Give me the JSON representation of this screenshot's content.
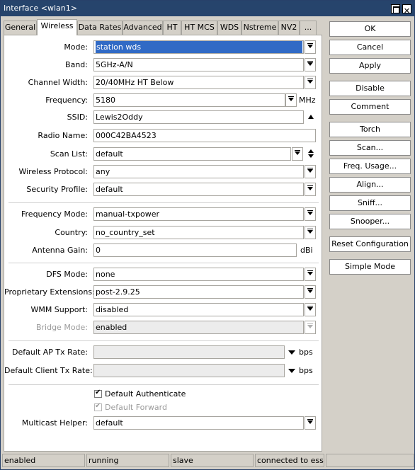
{
  "window": {
    "title": "Interface <wlan1>"
  },
  "tabs": [
    "General",
    "Wireless",
    "Data Rates",
    "Advanced",
    "HT",
    "HT MCS",
    "WDS",
    "Nstreme",
    "NV2",
    "..."
  ],
  "active_tab": "Wireless",
  "form": {
    "mode": {
      "label": "Mode:",
      "value": "station wds"
    },
    "band": {
      "label": "Band:",
      "value": "5GHz-A/N"
    },
    "channel_width": {
      "label": "Channel Width:",
      "value": "20/40MHz HT Below"
    },
    "frequency": {
      "label": "Frequency:",
      "value": "5180",
      "unit": "MHz"
    },
    "ssid": {
      "label": "SSID:",
      "value": "Lewis2Oddy"
    },
    "radio_name": {
      "label": "Radio Name:",
      "value": "000C42BA4523"
    },
    "scan_list": {
      "label": "Scan List:",
      "value": "default"
    },
    "wireless_protocol": {
      "label": "Wireless Protocol:",
      "value": "any"
    },
    "security_profile": {
      "label": "Security Profile:",
      "value": "default"
    },
    "frequency_mode": {
      "label": "Frequency Mode:",
      "value": "manual-txpower"
    },
    "country": {
      "label": "Country:",
      "value": "no_country_set"
    },
    "antenna_gain": {
      "label": "Antenna Gain:",
      "value": "0",
      "unit": "dBi"
    },
    "dfs_mode": {
      "label": "DFS Mode:",
      "value": "none"
    },
    "proprietary_extensions": {
      "label": "Proprietary Extensions:",
      "value": "post-2.9.25"
    },
    "wmm_support": {
      "label": "WMM Support:",
      "value": "disabled"
    },
    "bridge_mode": {
      "label": "Bridge Mode:",
      "value": "enabled"
    },
    "default_ap_tx_rate": {
      "label": "Default AP Tx Rate:",
      "value": "",
      "unit": "bps"
    },
    "default_client_tx_rate": {
      "label": "Default Client Tx Rate:",
      "value": "",
      "unit": "bps"
    },
    "default_authenticate": {
      "label": "Default Authenticate",
      "checked": true
    },
    "default_forward": {
      "label": "Default Forward",
      "checked": true
    },
    "multicast_helper": {
      "label": "Multicast Helper:",
      "value": "default"
    }
  },
  "buttons": {
    "ok": "OK",
    "cancel": "Cancel",
    "apply": "Apply",
    "disable": "Disable",
    "comment": "Comment",
    "torch": "Torch",
    "scan": "Scan...",
    "freq_usage": "Freq. Usage...",
    "align": "Align...",
    "sniff": "Sniff...",
    "snooper": "Snooper...",
    "reset_configuration": "Reset Configuration",
    "simple_mode": "Simple Mode"
  },
  "status": [
    "enabled",
    "running",
    "slave",
    "connected to ess",
    ""
  ]
}
